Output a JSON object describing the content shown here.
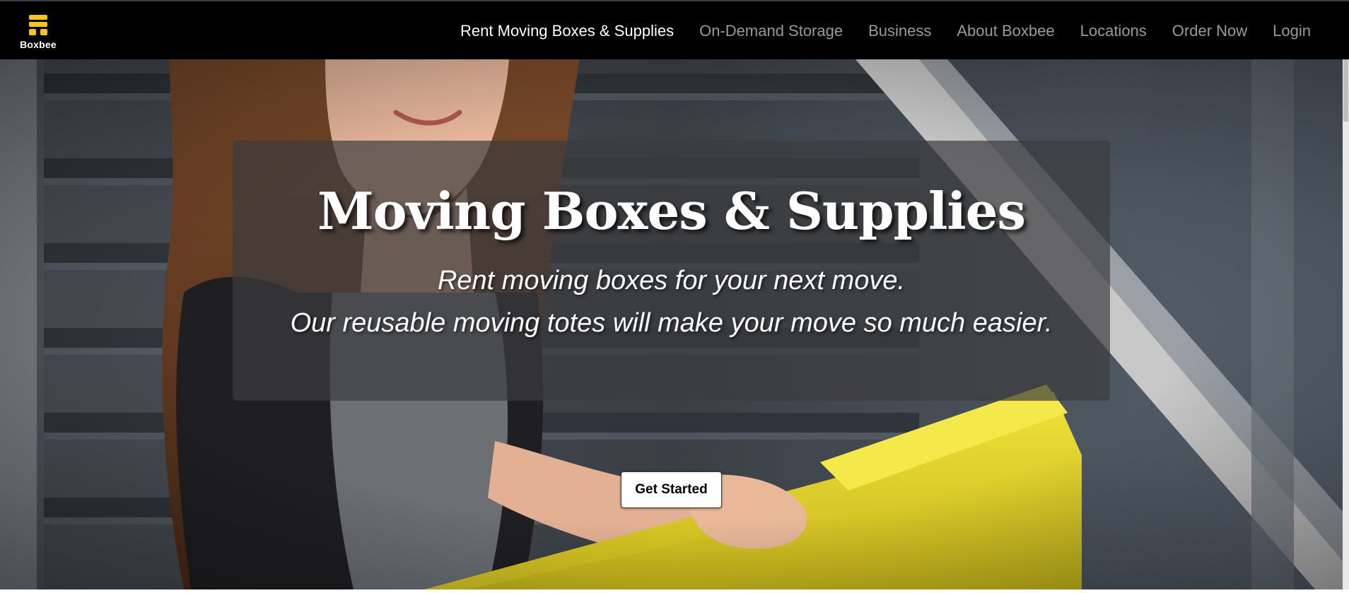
{
  "brand": {
    "name": "Boxbee",
    "logo_icon": "stacked-boxes-icon",
    "accent_color": "#f5c518"
  },
  "nav": {
    "items": [
      {
        "label": "Rent Moving Boxes & Supplies",
        "active": true
      },
      {
        "label": "On-Demand Storage",
        "active": false
      },
      {
        "label": "Business",
        "active": false
      },
      {
        "label": "About Boxbee",
        "active": false
      },
      {
        "label": "Locations",
        "active": false
      },
      {
        "label": "Order Now",
        "active": false
      },
      {
        "label": "Login",
        "active": false
      }
    ]
  },
  "hero": {
    "title": "Moving Boxes & Supplies",
    "subtitle_line1": "Rent moving boxes for your next move.",
    "subtitle_line2": "Our reusable moving totes will make your move so much easier.",
    "cta_label": "Get Started",
    "image_subject": "woman carrying yellow moving tote on stairs"
  }
}
